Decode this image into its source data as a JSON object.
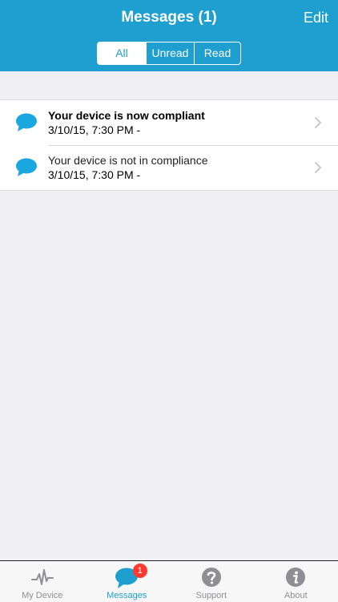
{
  "header": {
    "title": "Messages (1)",
    "edit_label": "Edit"
  },
  "filter": {
    "options": [
      "All",
      "Unread",
      "Read"
    ],
    "selected": "All"
  },
  "messages": [
    {
      "title": "Your device is now compliant",
      "date": "3/10/15, 7:30 PM -",
      "unread": true,
      "icon": "chat-bubble-icon"
    },
    {
      "title": "Your device is not in compliance",
      "date": "3/10/15, 7:30 PM -",
      "unread": false,
      "icon": "chat-bubble-icon"
    }
  ],
  "tabbar": {
    "tabs": [
      {
        "label": "My Device",
        "icon": "pulse-icon",
        "active": false
      },
      {
        "label": "Messages",
        "icon": "chat-bubble-icon",
        "active": true,
        "badge": "1"
      },
      {
        "label": "Support",
        "icon": "question-icon",
        "active": false
      },
      {
        "label": "About",
        "icon": "info-icon",
        "active": false
      }
    ]
  },
  "colors": {
    "accent": "#1e9fd0",
    "badge": "#ff3b30",
    "background": "#efeff4"
  }
}
